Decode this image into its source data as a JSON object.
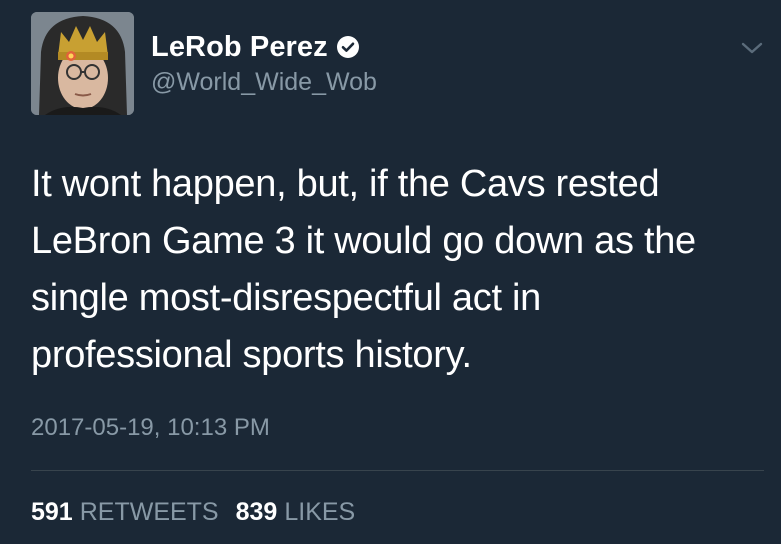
{
  "user": {
    "display_name": "LeRob Perez",
    "handle": "@World_Wide_Wob",
    "verified": true
  },
  "tweet": {
    "lines": [
      "It wont happen, but, if the Cavs rested",
      "LeBron Game 3 it would go down as the",
      "single most-disrespectful act in",
      "professional sports history."
    ],
    "timestamp": "2017-05-19, 10:13 PM"
  },
  "stats": {
    "retweets_count": "591",
    "retweets_label": "RETWEETS",
    "likes_count": "839",
    "likes_label": "LIKES"
  },
  "icons": {
    "verified": "verified-badge-icon",
    "menu": "chevron-down-icon",
    "avatar": "avatar"
  },
  "colors": {
    "background": "#1b2836",
    "primary_text": "#ffffff",
    "secondary_text": "#8899a6",
    "divider": "#38444d"
  }
}
